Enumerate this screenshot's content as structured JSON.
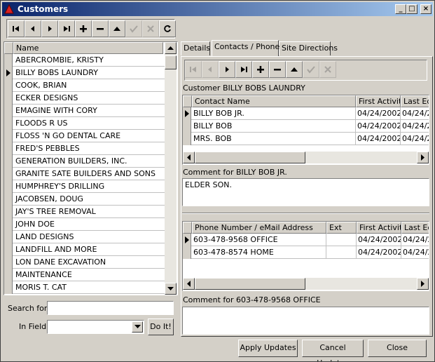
{
  "window": {
    "title": "Customers",
    "minimize": "_",
    "maximize": "□",
    "close": "×"
  },
  "customer_list": {
    "header": "Name",
    "items": [
      "ABERCROMBIE, KRISTY",
      "BILLY BOBS LAUNDRY",
      "COOK, BRIAN",
      "ECKER DESIGNS",
      "EMAGINE WITH CORY",
      "FLOODS R US",
      "FLOSS 'N GO DENTAL CARE",
      "FRED'S PEBBLES",
      "GENERATION BUILDERS, INC.",
      "GRANITE SATE BUILDERS AND SONS",
      "HUMPHREY'S DRILLING",
      "JACOBSEN, DOUG",
      "JAY'S TREE REMOVAL",
      "JOHN DOE",
      "LAND DESIGNS",
      "LANDFILL AND MORE",
      "LON DANE EXCAVATION",
      "MAINTENANCE",
      "MORIS T. CAT"
    ],
    "selected_index": 1
  },
  "search": {
    "search_label": "Search for",
    "search_value": "",
    "field_label": "In Field",
    "field_value": "",
    "do_it": "Do It!"
  },
  "tabs": [
    {
      "label": "Details"
    },
    {
      "label": "Contacts / Phone"
    },
    {
      "label": "Site Directions"
    }
  ],
  "contacts": {
    "customer_label": "Customer",
    "customer_name": "BILLY BOBS LAUNDRY",
    "columns": [
      "Contact Name",
      "First Activity",
      "Last Ed"
    ],
    "rows": [
      [
        "BILLY BOB JR.",
        "04/24/2002",
        "04/24/2"
      ],
      [
        "BILLY BOB",
        "04/24/2002",
        "04/24/2"
      ],
      [
        "MRS. BOB",
        "04/24/2002",
        "04/24/2"
      ]
    ],
    "comment_label": "Comment for",
    "comment_for": "BILLY BOB JR.",
    "comment": "ELDER SON."
  },
  "phones": {
    "columns": [
      "Phone Number / eMail Address",
      "Ext",
      "First Activity",
      "Last Ed"
    ],
    "rows": [
      [
        "603-478-9568 OFFICE",
        "",
        "04/24/2002",
        "04/24/2"
      ],
      [
        "603-478-8574 HOME",
        "",
        "04/24/2002",
        "04/24/2"
      ]
    ],
    "comment_label": "Comment for",
    "comment_for": "603-478-9568 OFFICE",
    "comment": ""
  },
  "buttons": {
    "apply": "Apply Updates",
    "cancel": "Cancel Updates",
    "close": "Close"
  },
  "icons": {
    "first": "first-record-icon",
    "prev": "prior-record-icon",
    "next": "next-record-icon",
    "last": "last-record-icon",
    "insert": "plus-icon",
    "delete": "minus-icon",
    "edit": "edit-arrow-icon",
    "post": "check-icon",
    "cancel": "x-icon",
    "refresh": "refresh-icon"
  }
}
